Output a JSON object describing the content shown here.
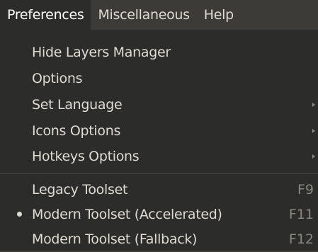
{
  "menubar": {
    "items": [
      {
        "label": "Preferences"
      },
      {
        "label": "Miscellaneous"
      },
      {
        "label": "Help"
      }
    ]
  },
  "menu": {
    "items": [
      {
        "label": "Hide Layers Manager"
      },
      {
        "label": "Options"
      },
      {
        "label": "Set Language",
        "submenu": true
      },
      {
        "label": "Icons Options",
        "submenu": true
      },
      {
        "label": "Hotkeys Options",
        "submenu": true
      },
      {
        "label": "Legacy Toolset",
        "shortcut": "F9"
      },
      {
        "label": "Modern Toolset (Accelerated)",
        "shortcut": "F11",
        "selected": true
      },
      {
        "label": "Modern Toolset (Fallback)",
        "shortcut": "F12"
      }
    ]
  },
  "colors": {
    "menubar_bg": "#3c3b37",
    "menu_bg": "#2c2c2a",
    "text": "#dfdbd2",
    "muted": "#8a877f"
  }
}
